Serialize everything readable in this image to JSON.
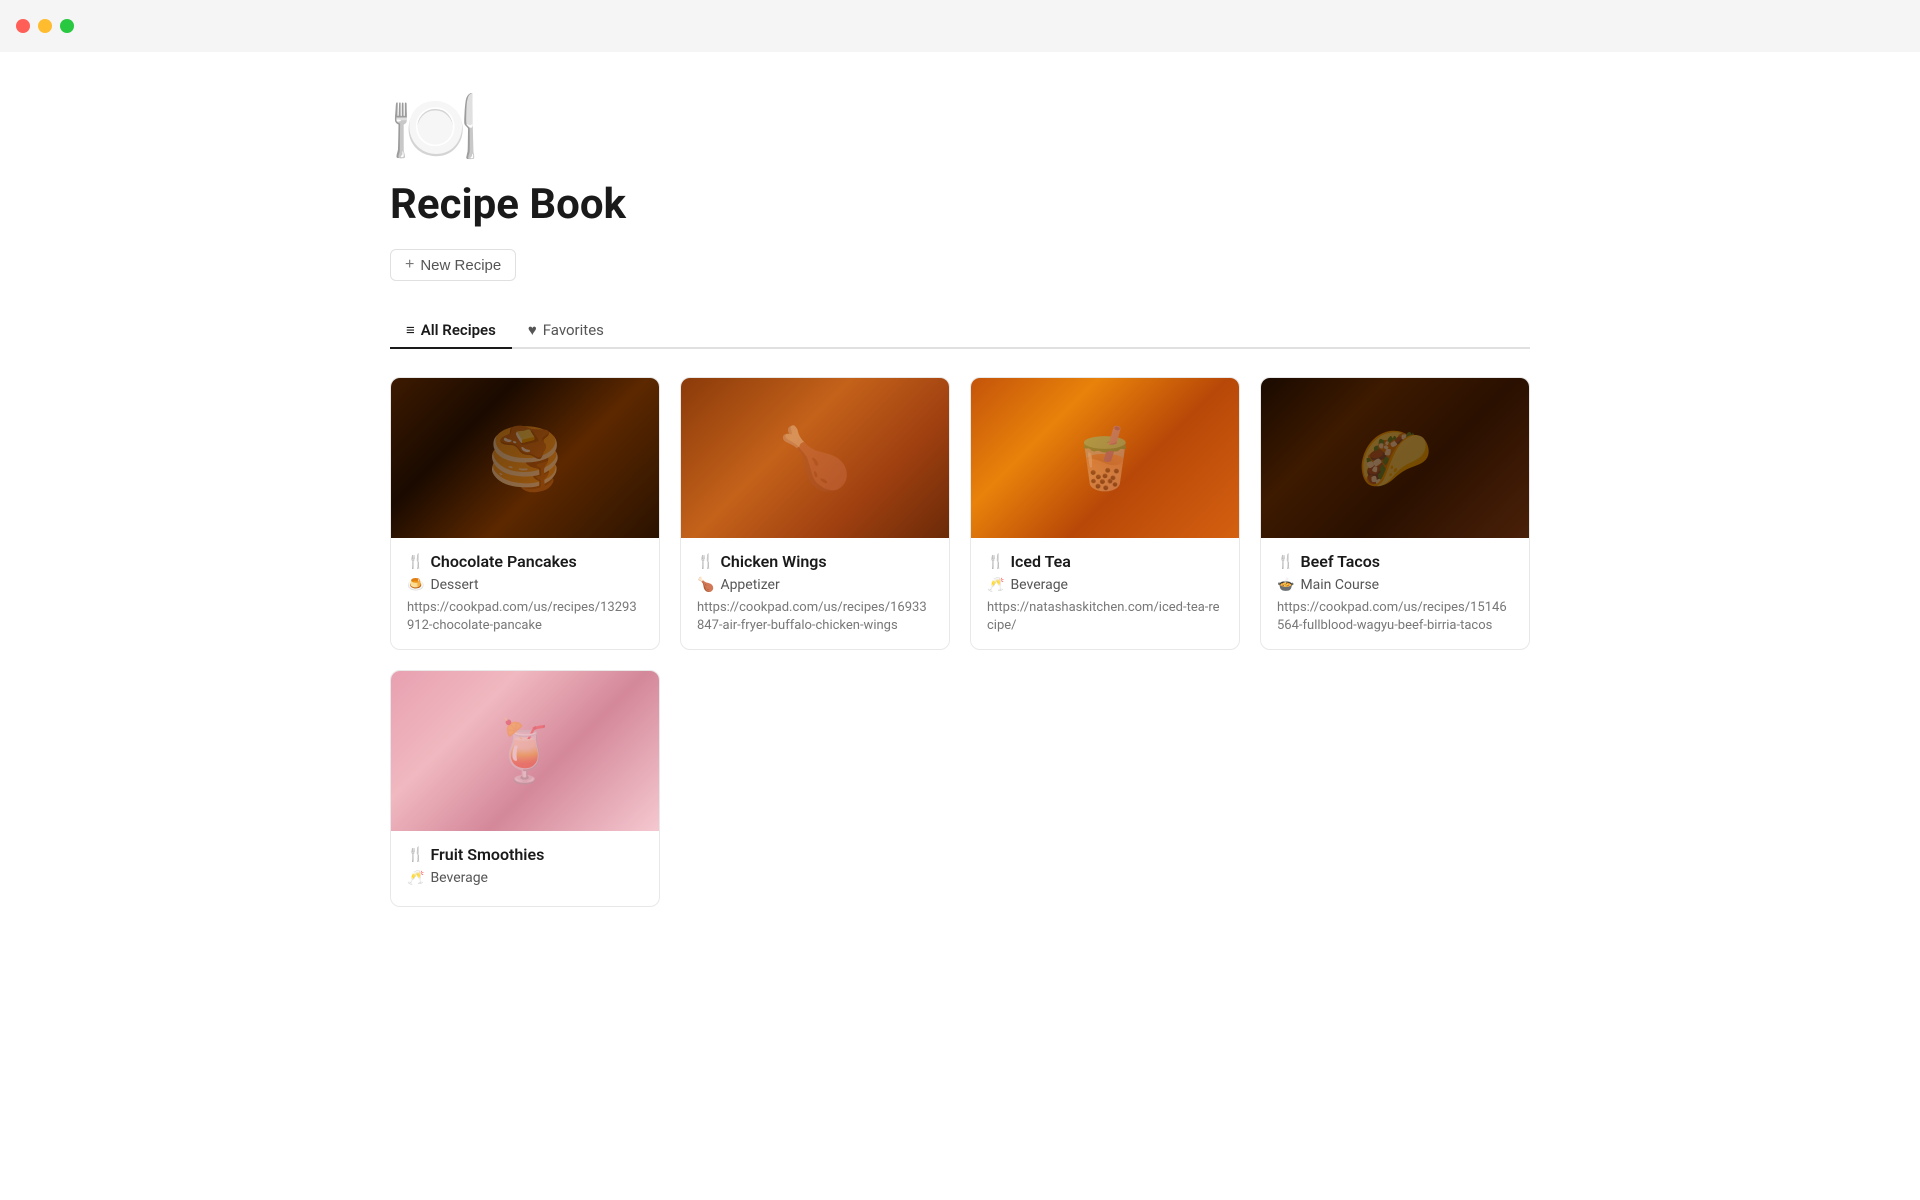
{
  "titlebar": {
    "close_label": "",
    "minimize_label": "",
    "maximize_label": ""
  },
  "page": {
    "icon": "🍽️",
    "title": "Recipe Book",
    "new_recipe_label": "New Recipe",
    "new_recipe_plus": "+"
  },
  "tabs": [
    {
      "id": "all-recipes",
      "label": "All Recipes",
      "icon": "≡",
      "active": true
    },
    {
      "id": "favorites",
      "label": "Favorites",
      "icon": "♥",
      "active": false
    }
  ],
  "recipes": [
    {
      "id": "chocolate-pancakes",
      "name": "Chocolate Pancakes",
      "name_icon": "🍴",
      "category": "Dessert",
      "category_icon": "🍮",
      "url": "https://cookpad.com/us/recipes/13293912-chocolate-pancake",
      "image_class": "img-chocolate",
      "image_emoji": "🥞"
    },
    {
      "id": "chicken-wings",
      "name": "Chicken Wings",
      "name_icon": "🍴",
      "category": "Appetizer",
      "category_icon": "🍗",
      "url": "https://cookpad.com/us/recipes/16933847-air-fryer-buffalo-chicken-wings",
      "image_class": "img-chicken",
      "image_emoji": "🍗"
    },
    {
      "id": "iced-tea",
      "name": "Iced Tea",
      "name_icon": "🍴",
      "category": "Beverage",
      "category_icon": "🥂",
      "url": "https://natashaskitchen.com/iced-tea-recipe/",
      "image_class": "img-icedtea",
      "image_emoji": "🧋"
    },
    {
      "id": "beef-tacos",
      "name": "Beef Tacos",
      "name_icon": "🍴",
      "category": "Main Course",
      "category_icon": "🍲",
      "url": "https://cookpad.com/us/recipes/15146564-fullblood-wagyu-beef-birria-tacos",
      "image_class": "img-beeftacos",
      "image_emoji": "🌮"
    },
    {
      "id": "fruit-smoothies",
      "name": "Fruit Smoothies",
      "name_icon": "🍴",
      "category": "Beverage",
      "category_icon": "🥂",
      "url": "",
      "image_class": "img-smoothies",
      "image_emoji": "🍹"
    }
  ]
}
